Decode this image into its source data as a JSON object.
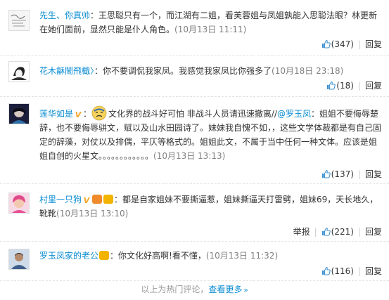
{
  "comments": [
    {
      "user": "先生、你真帅",
      "text_before": "：王思聪只有一个，而江湖有二姐，看芙蓉姐与凤姐孰能入思聪法眼？林更新在她们面前，显然只能是仆人角色。",
      "time": "(10月13日 11:11)",
      "like_count": "(347)",
      "reply_label": "回复"
    },
    {
      "user": "花木龢鬧飛檝〉",
      "text_before": "：你不要调侃我家凤。我感觉我家凤比你强多了",
      "time": "(10月18日 23:18)",
      "like_count": "(18)",
      "reply_label": "回复"
    },
    {
      "user": "莲华如是",
      "text_before": "文化界的战斗好可怕 非战斗人员请迅速撤离//",
      "mention": "@罗玉凤",
      "text_after": "：姐姐不要侮辱楚辞，也不要侮辱骈文，赋以及山水田园诗了。妹妹我自愧不如，，这些文学体裁都是有自己固定的辞藻，对仗以及排偶，平仄等格式的。姐姐此文，不属于当中任何一种文体。应该是姐姐自创的火星文。。。。。。。。。。。。",
      "time": "(10月13日 13:13)",
      "like_count": "(137)",
      "reply_label": "回复"
    },
    {
      "user": "村里一只狗",
      "text_before": "：都是自家姐妹不要撕逼惹，姐妹撕逼天打雷劈，姐妹69，天长地久，靴靴",
      "time": "(10月13日 13:10)",
      "report_label": "举报",
      "like_count": "(221)",
      "reply_label": "回复"
    },
    {
      "user": "罗玉凤家的老公",
      "text_before": "：你文化好高啊!看不懂，",
      "time": "(10月13日 11:32)",
      "like_count": "(116)",
      "reply_label": "回复"
    }
  ],
  "footer": {
    "text": "以上为热门评论，",
    "more_label": "查看更多",
    "more_arrow": "»"
  },
  "colors": {
    "link": "#0a8cd2",
    "time": "#808080",
    "like_blue": "#3a8fd1"
  }
}
